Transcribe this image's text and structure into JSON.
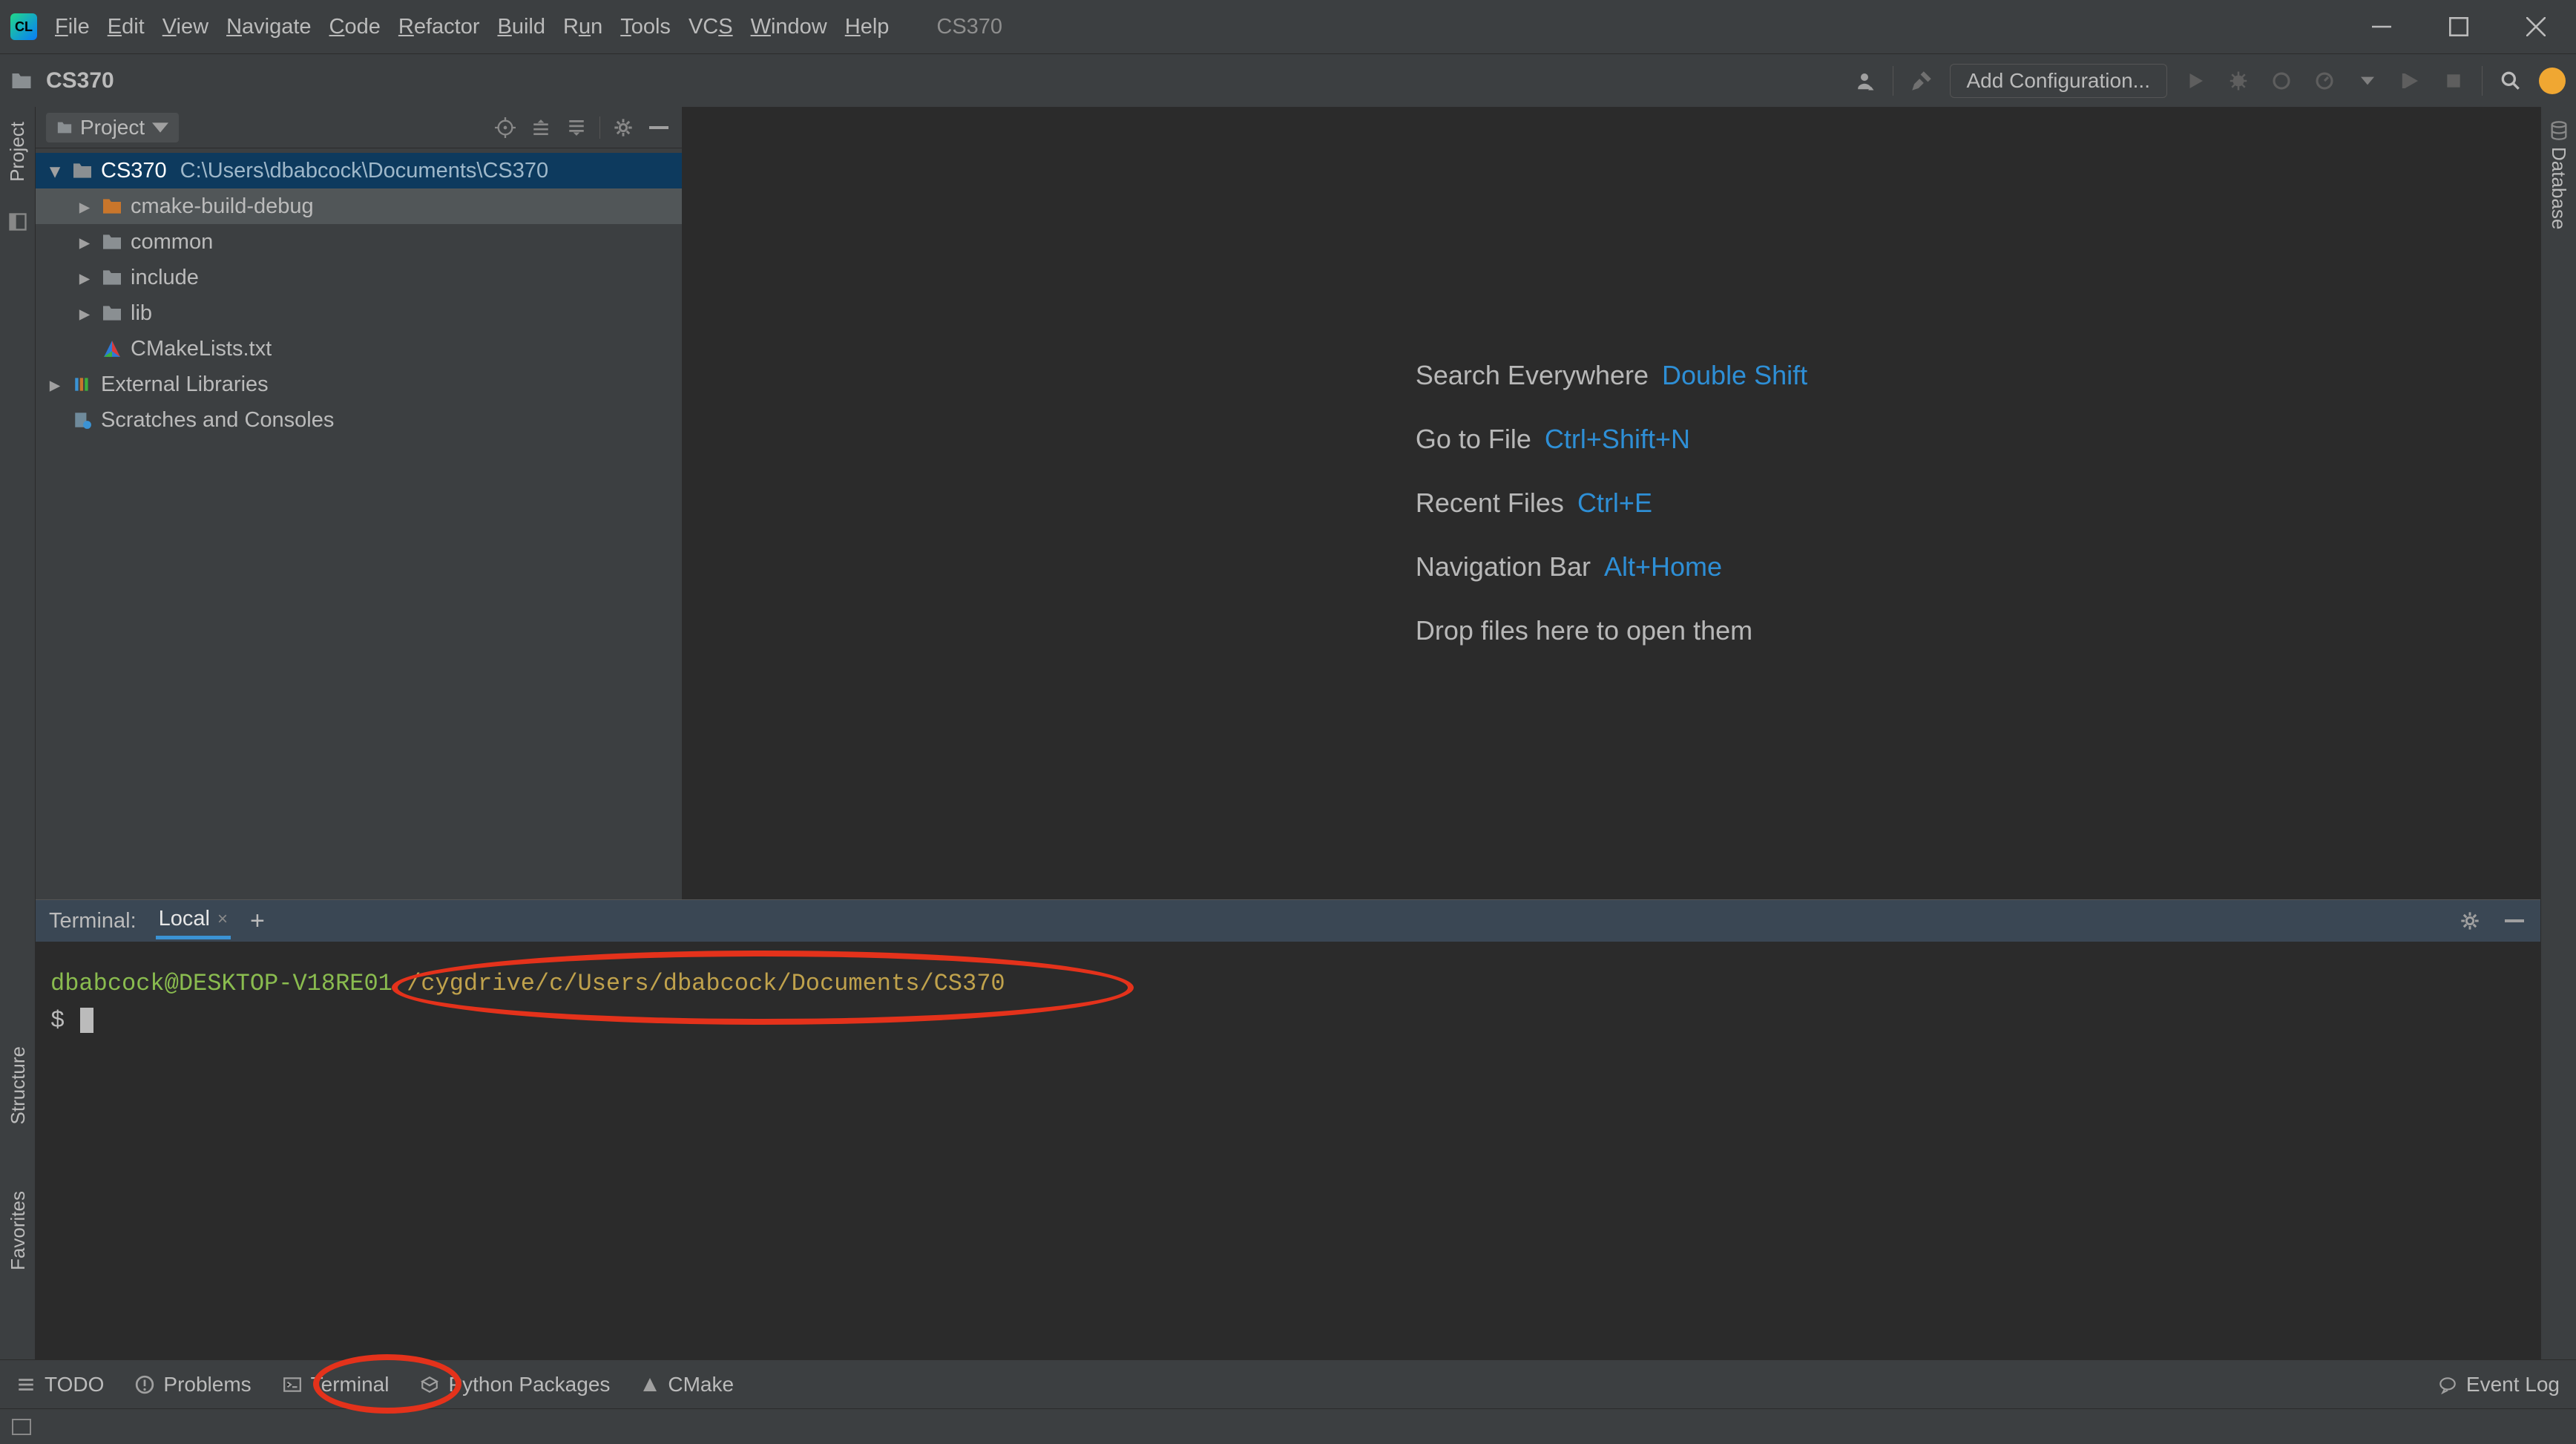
{
  "menu": {
    "items": [
      "File",
      "Edit",
      "View",
      "Navigate",
      "Code",
      "Refactor",
      "Build",
      "Run",
      "Tools",
      "VCS",
      "Window",
      "Help"
    ],
    "project": "CS370"
  },
  "breadcrumb": {
    "project": "CS370"
  },
  "toolbar": {
    "addconfig": "Add Configuration..."
  },
  "project_view": {
    "title": "Project",
    "root": {
      "name": "CS370",
      "path": "C:\\Users\\dbabcock\\Documents\\CS370"
    },
    "children": [
      {
        "name": "cmake-build-debug",
        "kind": "folder-orange",
        "expandable": true
      },
      {
        "name": "common",
        "kind": "folder",
        "expandable": true
      },
      {
        "name": "include",
        "kind": "folder",
        "expandable": true
      },
      {
        "name": "lib",
        "kind": "folder",
        "expandable": true
      },
      {
        "name": "CMakeLists.txt",
        "kind": "cmake",
        "expandable": false
      }
    ],
    "external": "External Libraries",
    "scratches": "Scratches and Consoles"
  },
  "editor_tips": {
    "rows": [
      {
        "label": "Search Everywhere",
        "key": "Double Shift"
      },
      {
        "label": "Go to File",
        "key": "Ctrl+Shift+N"
      },
      {
        "label": "Recent Files",
        "key": "Ctrl+E"
      },
      {
        "label": "Navigation Bar",
        "key": "Alt+Home"
      }
    ],
    "drop": "Drop files here to open them"
  },
  "terminal": {
    "title": "Terminal:",
    "tab": "Local",
    "user": "dbabcock@DESKTOP-V18RE01",
    "path": "/cygdrive/c/Users/dbabcock/Documents/CS370",
    "prompt": "$"
  },
  "bottom": {
    "items": [
      "TODO",
      "Problems",
      "Terminal",
      "Python Packages",
      "CMake"
    ],
    "eventlog": "Event Log"
  },
  "right_panel": {
    "label": "Database"
  },
  "left_panel": {
    "label": "Project",
    "lower": [
      "Structure",
      "Favorites"
    ]
  }
}
